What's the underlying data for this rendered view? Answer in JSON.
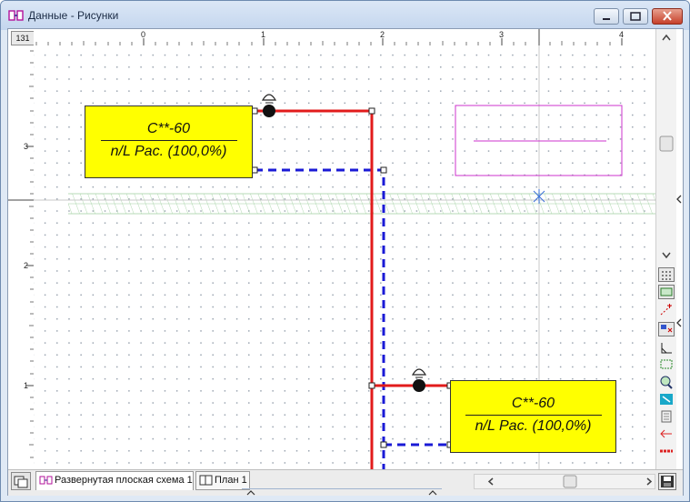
{
  "window": {
    "title": "Данные - Рисунки",
    "controls": {
      "minimize": "minimize",
      "maximize": "maximize",
      "close": "close"
    }
  },
  "ruler": {
    "corner": "131",
    "h_ticks": [
      "0",
      "1",
      "2",
      "3",
      "4"
    ],
    "v_ticks": [
      "3",
      "2",
      "1"
    ]
  },
  "drawing": {
    "label_top": {
      "line1": "C**-60",
      "line2": "n/L Рас. (100,0%)"
    },
    "label_bottom": {
      "line1": "C**-60",
      "line2": "n/L Рас. (100,0%)"
    },
    "colors": {
      "pipe": "#e21b1b",
      "dashed": "#1a1ad6",
      "label_fill": "#ffff00",
      "magenta": "#cc33cc",
      "hatch": "#9fcf9f"
    }
  },
  "tabs": [
    {
      "label": "Развернутая плоская схема 1",
      "active": true
    },
    {
      "label": "План 1",
      "active": false
    }
  ],
  "tools": [
    "grid-tool-icon",
    "layer-tool-icon",
    "snap-tool-icon",
    "node-tool-icon",
    "angle-tool-icon",
    "frame-tool-icon",
    "zoom-icon",
    "fit-icon",
    "hatch-icon",
    "arrow-left-red-icon",
    "red-dash-icon",
    "save-icon"
  ]
}
